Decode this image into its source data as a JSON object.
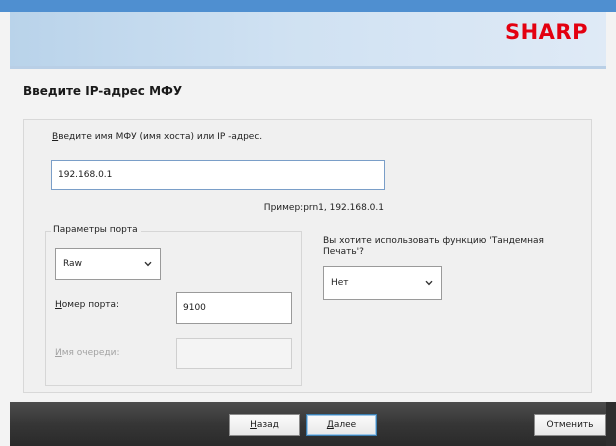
{
  "window": {
    "title": ""
  },
  "header": {
    "brand": "SHARP"
  },
  "page": {
    "title": "Введите IP-адрес МФУ"
  },
  "host": {
    "label": "Введите имя МФУ (имя хоста) или IP -адрес.",
    "value": "192.168.0.1",
    "example": "Пример:prn1, 192.168.0.1"
  },
  "port_params": {
    "legend": "Параметры порта",
    "port_type": "Raw",
    "port_number_label": "Номер порта:",
    "port_number_value": "9100",
    "queue_label": "Имя очереди:",
    "queue_value": ""
  },
  "tandem": {
    "question": "Вы хотите использовать функцию 'Тандемная Печать'?",
    "selected": "Нет"
  },
  "footer": {
    "back_label": "Назад",
    "next_label": "Далее",
    "cancel_label": "Отменить"
  },
  "colors": {
    "brand_red": "#e30010",
    "titlebar_blue": "#4f8fd0",
    "banner_blue": "#cfe1f2",
    "footer_dark": "#363636"
  },
  "icons": {
    "dropdown": "chevron-down-icon"
  }
}
